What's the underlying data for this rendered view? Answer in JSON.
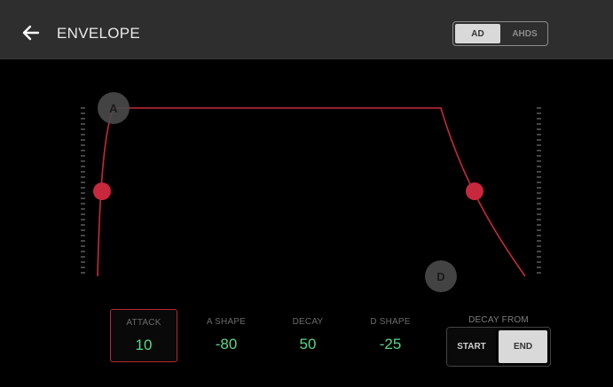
{
  "header": {
    "title": "ENVELOPE",
    "mode_options": [
      "AD",
      "AHDS"
    ],
    "mode_selected": "AD"
  },
  "envelope": {
    "attack_handle_label": "A",
    "decay_handle_label": "D"
  },
  "params": [
    {
      "label": "ATTACK",
      "value": "10",
      "selected": true
    },
    {
      "label": "A SHAPE",
      "value": "-80",
      "selected": false
    },
    {
      "label": "DECAY",
      "value": "50",
      "selected": false
    },
    {
      "label": "D SHAPE",
      "value": "-25",
      "selected": false
    }
  ],
  "decay_from": {
    "label": "DECAY FROM",
    "options": [
      "START",
      "END"
    ],
    "selected": "END"
  },
  "colors": {
    "accent_red": "#c8283c",
    "value_green": "#55d98a",
    "header_bg": "#2e2e2e"
  },
  "icons": {
    "back": "arrow-left-icon"
  }
}
